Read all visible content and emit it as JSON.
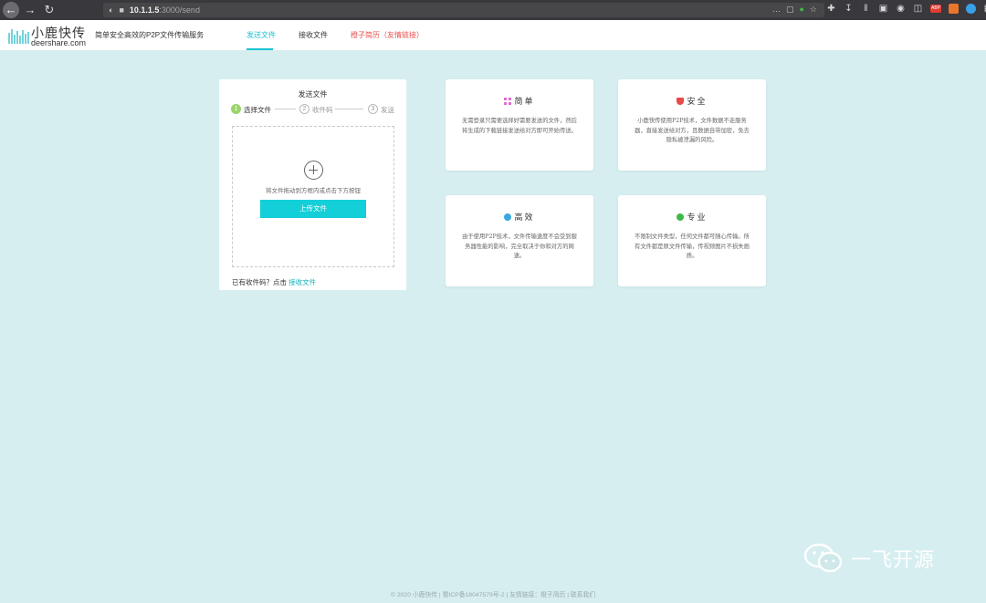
{
  "browser": {
    "url_host": "10.1.1.5",
    "url_path": ":3000/send",
    "toolbar_badge": "ABP"
  },
  "site": {
    "logo_cn": "小鹿快传",
    "logo_en": "deershare.com",
    "slogan": "简单安全高效的P2P文件传输服务",
    "nav": [
      {
        "label": "发送文件"
      },
      {
        "label": "接收文件"
      },
      {
        "label": "橙子简历（友情链接）"
      }
    ]
  },
  "upload": {
    "title": "发送文件",
    "steps": [
      {
        "num": "1",
        "label": "选择文件"
      },
      {
        "num": "2",
        "label": "收件码"
      },
      {
        "num": "3",
        "label": "发送"
      }
    ],
    "drop_hint": "将文件拖动到方框内或点击下方按钮",
    "button_label": "上传文件",
    "have_code_prefix": "已有收件码？点击 ",
    "have_code_link": "接收文件"
  },
  "features": [
    {
      "title": "简单",
      "icon": "grid-icon",
      "body": "无需登录只需要选择好需要发送的文件，然后将生成的下载链接发送给对方即可开始传送。"
    },
    {
      "title": "安全",
      "icon": "shield-icon",
      "body": "小鹿快传使用P2P技术，文件数据不走服务器，直接发送给对方，且数据自带加密，免去隐私被泄漏的风险。"
    },
    {
      "title": "高效",
      "icon": "gauge-icon",
      "body": "由于使用P2P技术，文件传输速度不会受到服务器性能的影响，完全取决于你和对方的网速。"
    },
    {
      "title": "专业",
      "icon": "check-icon",
      "body": "不限制文件类型，任何文件都可随心传输。所有文件都是原文件传输，传视频图片不损失画质。"
    }
  ],
  "footer": "© 2020 小鹿快传 | 蜀ICP备18047579号-2 | 友情链接：橙子简历 | 联系我们",
  "watermark": "一飞开源",
  "colors": {
    "accent": "#17c3d2",
    "button": "#13cfd8",
    "step_active": "#9bd46b",
    "link_red": "#e85050"
  }
}
